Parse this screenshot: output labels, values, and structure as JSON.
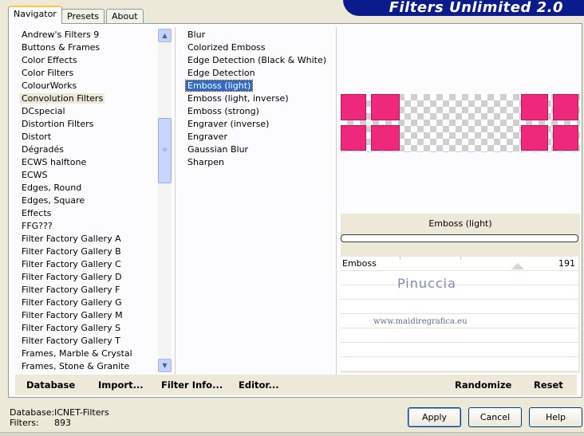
{
  "tabs": [
    "Navigator",
    "Presets",
    "About"
  ],
  "banner": {
    "title": "Filters Unlimited 2.0"
  },
  "categories": [
    "Andrew's Filters 9",
    "Buttons & Frames",
    "Color Effects",
    "Color Filters",
    "ColourWorks",
    "Convolution Filters",
    "DCspecial",
    "Distortion Filters",
    "Distort",
    "Dégradés",
    "ECWS halftone",
    "ECWS",
    "Edges, Round",
    "Edges, Square",
    "Effects",
    "FFG???",
    "Filter Factory Gallery A",
    "Filter Factory Gallery B",
    "Filter Factory Gallery C",
    "Filter Factory Gallery D",
    "Filter Factory Gallery F",
    "Filter Factory Gallery G",
    "Filter Factory Gallery M",
    "Filter Factory Gallery S",
    "Filter Factory Gallery T",
    "Frames, Marble & Crystal",
    "Frames, Stone & Granite"
  ],
  "selected_category": "Convolution Filters",
  "filters": [
    "Blur",
    "Colorized Emboss",
    "Edge Detection (Black & White)",
    "Edge Detection",
    "Emboss (light)",
    "Emboss (light, inverse)",
    "Emboss (strong)",
    "Engraver (inverse)",
    "Engraver",
    "Gaussian Blur",
    "Sharpen"
  ],
  "selected_filter": "Emboss (light)",
  "preview": {
    "filter_name": "Emboss (light)",
    "block_color": "#f0287c"
  },
  "params": [
    {
      "label": "Emboss",
      "value": "191"
    }
  ],
  "watermark": {
    "line1": "Pinuccia",
    "line2": "www.maidiregrafica.eu"
  },
  "bottom_links": {
    "database": "Database",
    "import": "Import...",
    "filter_info": "Filter Info...",
    "editor": "Editor...",
    "randomize": "Randomize",
    "reset": "Reset"
  },
  "footer": {
    "database_label": "Database:",
    "database_value": "ICNET-Filters",
    "filters_label": "Filters:",
    "filters_value": "893"
  },
  "buttons": {
    "apply": "Apply",
    "cancel": "Cancel",
    "help": "Help"
  }
}
